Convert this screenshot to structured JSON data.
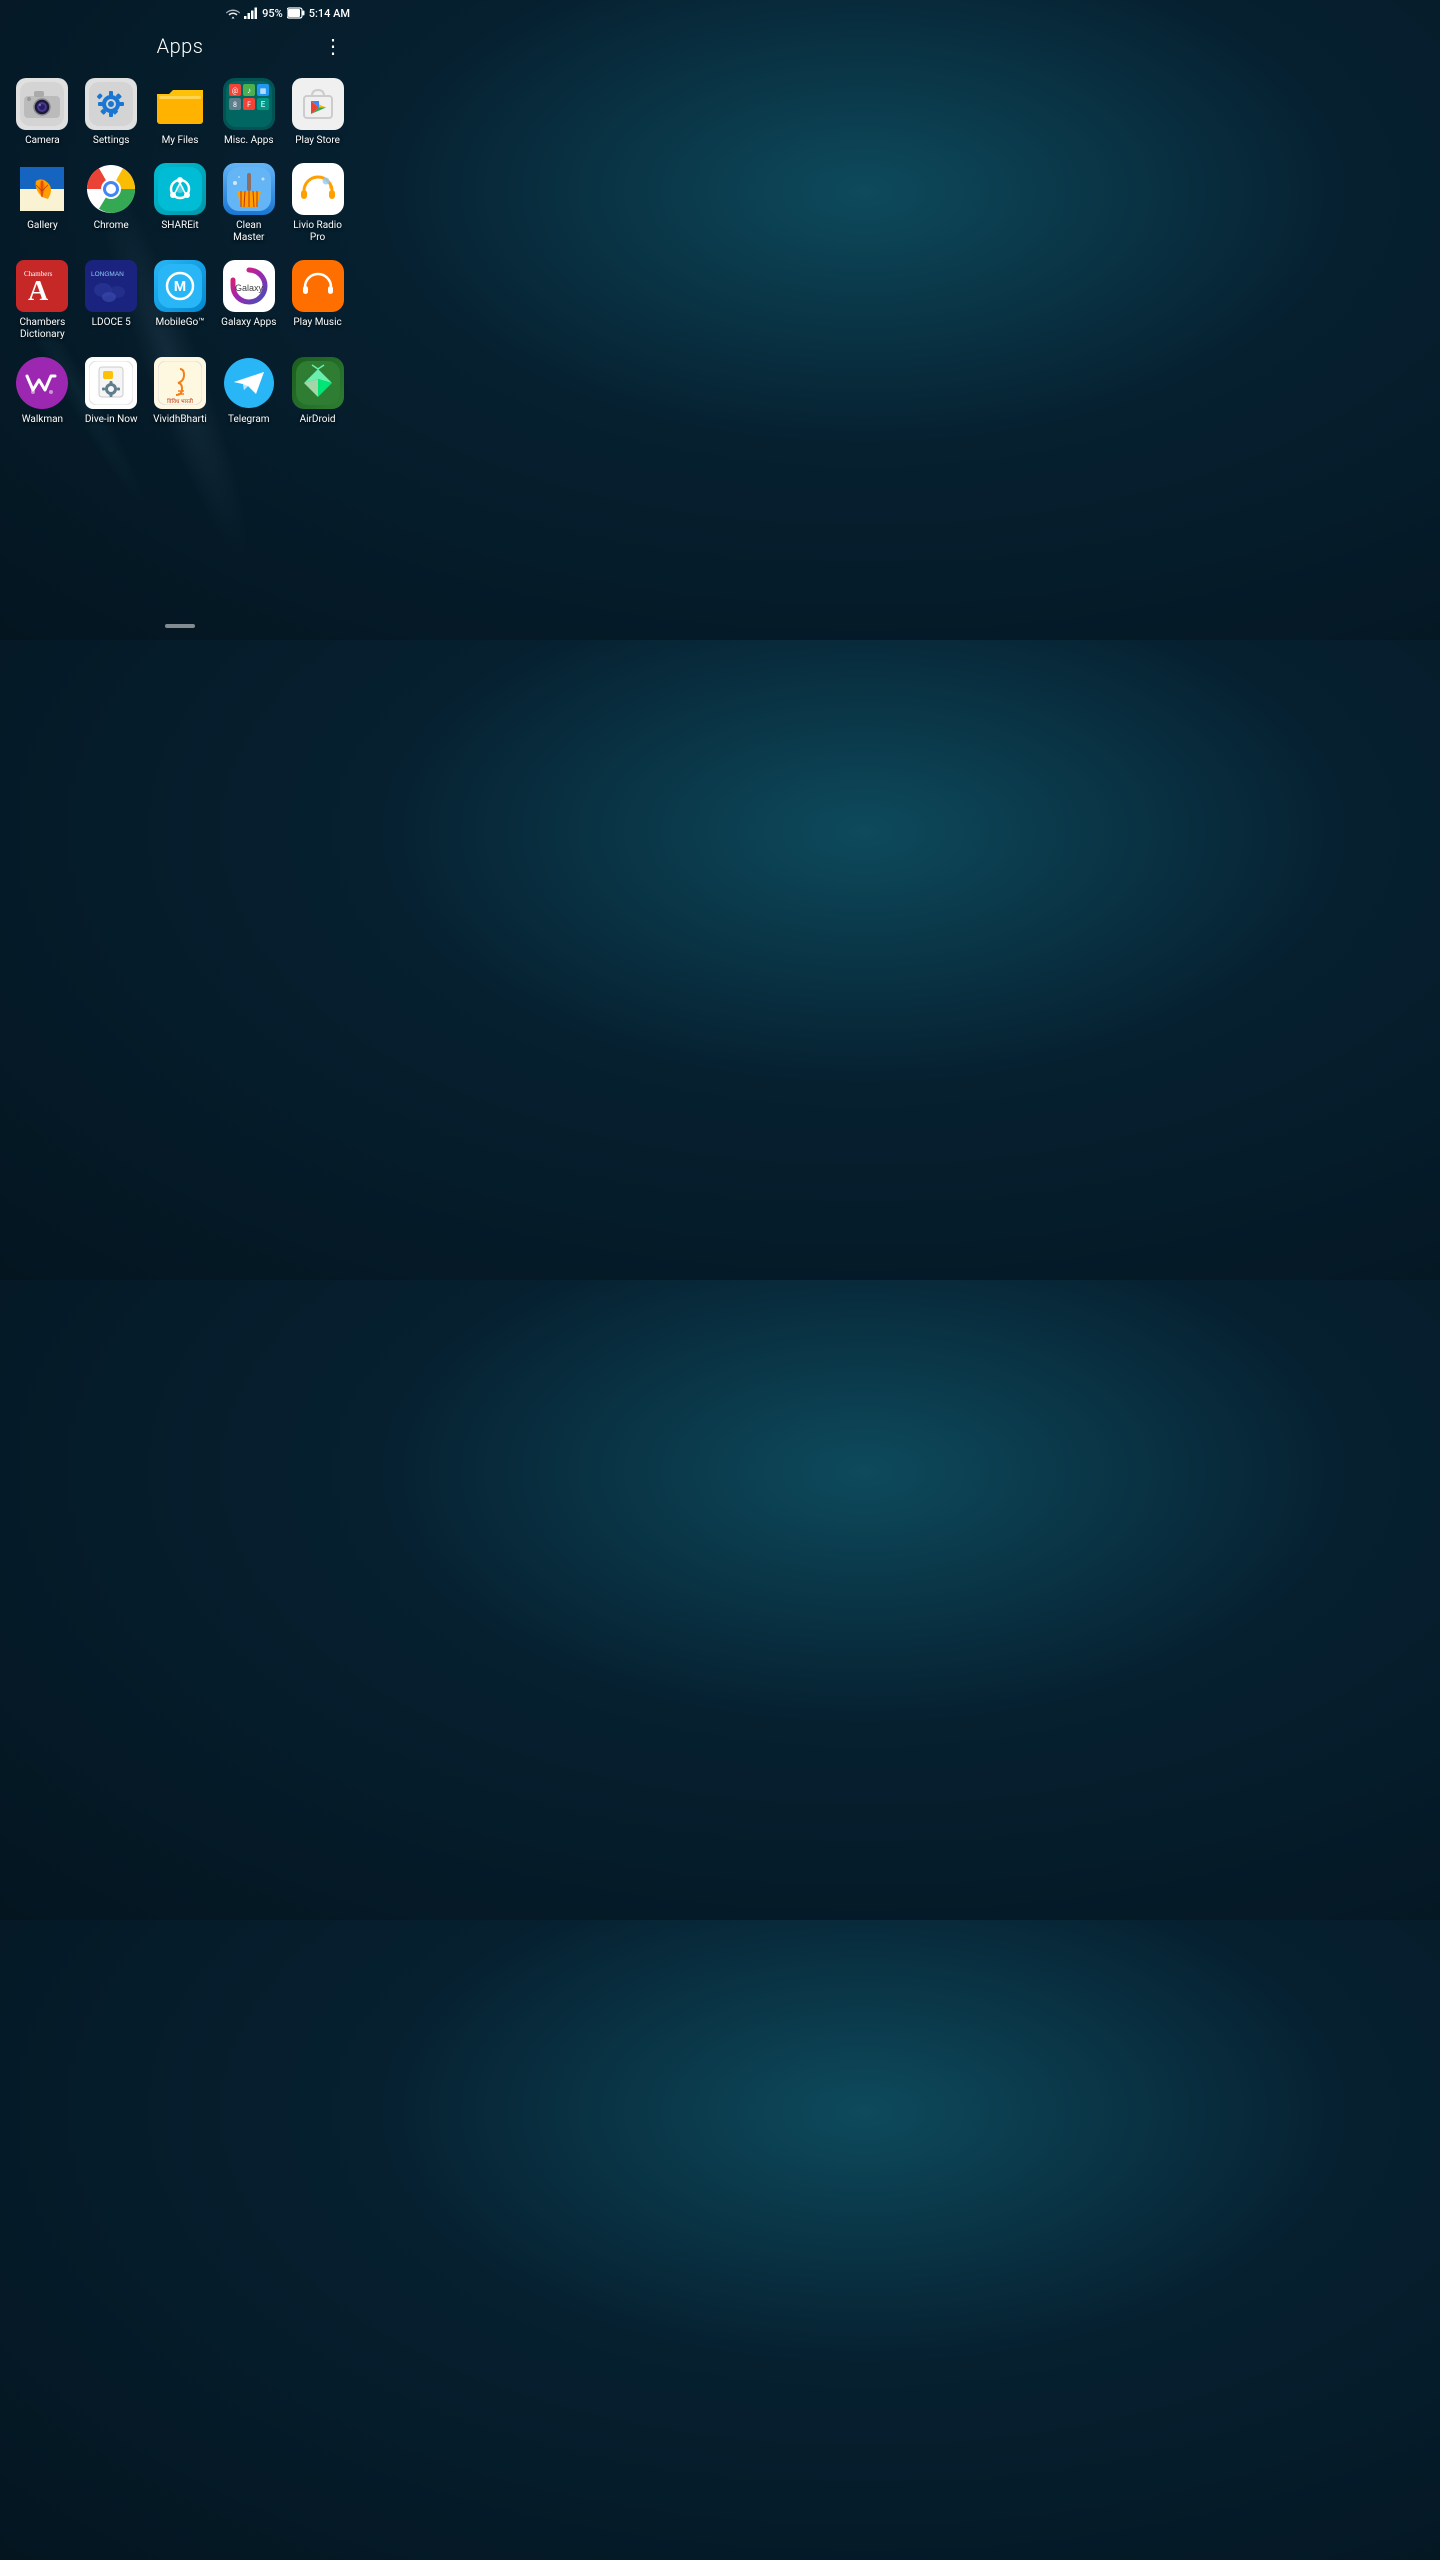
{
  "statusBar": {
    "battery": "95%",
    "time": "5:14 AM"
  },
  "header": {
    "title": "Apps",
    "menuIcon": "⋮"
  },
  "rows": [
    {
      "apps": [
        {
          "id": "camera",
          "label": "Camera"
        },
        {
          "id": "settings",
          "label": "Settings"
        },
        {
          "id": "myfiles",
          "label": "My Files"
        },
        {
          "id": "misc",
          "label": "Misc. Apps"
        },
        {
          "id": "playstore",
          "label": "Play Store"
        }
      ]
    },
    {
      "apps": [
        {
          "id": "gallery",
          "label": "Gallery"
        },
        {
          "id": "chrome",
          "label": "Chrome"
        },
        {
          "id": "shareit",
          "label": "SHAREit"
        },
        {
          "id": "cleanmaster",
          "label": "Clean\nMaster"
        },
        {
          "id": "livio",
          "label": "Livio Radio Pro"
        }
      ]
    },
    {
      "apps": [
        {
          "id": "chambers",
          "label": "Chambers Dictionary"
        },
        {
          "id": "ldoce",
          "label": "LDOCE 5"
        },
        {
          "id": "mobilego",
          "label": "MobileGo™"
        },
        {
          "id": "galaxy",
          "label": "Galaxy Apps"
        },
        {
          "id": "playmusic",
          "label": "Play Music"
        }
      ]
    },
    {
      "apps": [
        {
          "id": "walkman",
          "label": "Walkman"
        },
        {
          "id": "divein",
          "label": "Dive-in Now"
        },
        {
          "id": "vividh",
          "label": "VividhBharti"
        },
        {
          "id": "telegram",
          "label": "Telegram"
        },
        {
          "id": "airdroid",
          "label": "AirDroid"
        }
      ]
    }
  ]
}
